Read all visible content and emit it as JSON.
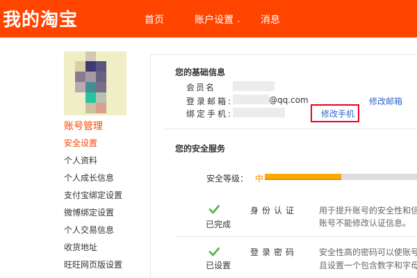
{
  "header": {
    "logo": "我的淘宝",
    "nav": {
      "home": "首页",
      "account": "账户设置",
      "account_caret": "⌄",
      "messages": "消息"
    }
  },
  "sidebar": {
    "title": "账号管理",
    "items": [
      {
        "label": "安全设置",
        "active": true
      },
      {
        "label": "个人资料"
      },
      {
        "label": "个人成长信息"
      },
      {
        "label": "支付宝绑定设置"
      },
      {
        "label": "微博绑定设置"
      },
      {
        "label": "个人交易信息"
      },
      {
        "label": "收货地址"
      },
      {
        "label": "旺旺网页版设置"
      }
    ]
  },
  "basic_info": {
    "title": "您的基础信息",
    "member_label": "会员名",
    "email_label": "登录邮箱:",
    "email_suffix": "@qq.com",
    "email_link": "修改邮箱",
    "phone_label": "绑定手机:",
    "phone_link": "修改手机"
  },
  "security": {
    "title": "您的安全服务",
    "level_label": "安全等级：",
    "level_value": "中",
    "level_fraction": 0.5,
    "services": [
      {
        "status": "已完成",
        "name": "身份认证",
        "desc_line1": "用于提升账号的安全性和信",
        "desc_line2": "账号不能修改认证信息。",
        "icon": "check-icon"
      },
      {
        "status": "已设置",
        "name": "登录密码",
        "desc_line1": "安全性高的密码可以使账号",
        "desc_line2": "且设置一个包含数字和字母",
        "icon": "check-icon"
      }
    ]
  },
  "colors": {
    "brand": "#ff4400",
    "link": "#3366cc",
    "highlight": "#e8001c",
    "level_bar": "#ffaa00",
    "check": "#5cb85c"
  }
}
